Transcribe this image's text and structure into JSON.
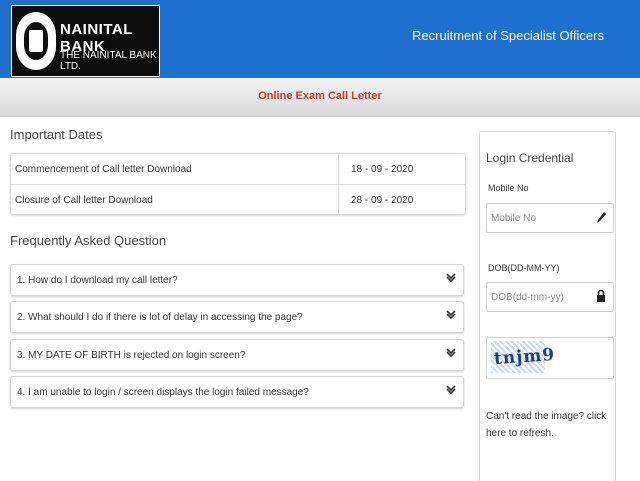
{
  "header": {
    "bank_name": "NAINITAL BANK",
    "bank_subtitle": "THE NAINITAL BANK LTD.",
    "recruitment_title": "Recruitment of Specialist Officers"
  },
  "subbar": {
    "title": "Online Exam Call Letter"
  },
  "important_dates": {
    "title": "Important Dates",
    "rows": [
      {
        "label": "Commencement of Call letter Download",
        "value": "18 - 09 - 2020"
      },
      {
        "label": "Closure of Call letter Download",
        "value": "28 - 09 - 2020"
      }
    ]
  },
  "faq": {
    "title": "Frequently Asked Question",
    "items": [
      "1. How do I download my call letter?",
      "2. What should I do if there is lot of delay in accessing the page?",
      "3. MY DATE OF BIRTH is rejected on login screen?",
      "4. I am unable to login / screen displays the login failed message?"
    ]
  },
  "login": {
    "title": "Login Credential",
    "mobile_label": "Mobile No",
    "mobile_placeholder": "Mobile No",
    "dob_label": "DOB(DD-MM-YY)",
    "dob_placeholder": "DOB(dd-mm-yy)",
    "captcha_text": "tnjm9",
    "refresh_text": "Can't read the image? click here to refresh."
  },
  "colors": {
    "header_blue": "#1d6fd0",
    "subbar_red": "#c0392b"
  },
  "icons": {
    "chevron": "chevron-down-icon",
    "pencil": "pencil-icon",
    "lock": "lock-icon"
  }
}
